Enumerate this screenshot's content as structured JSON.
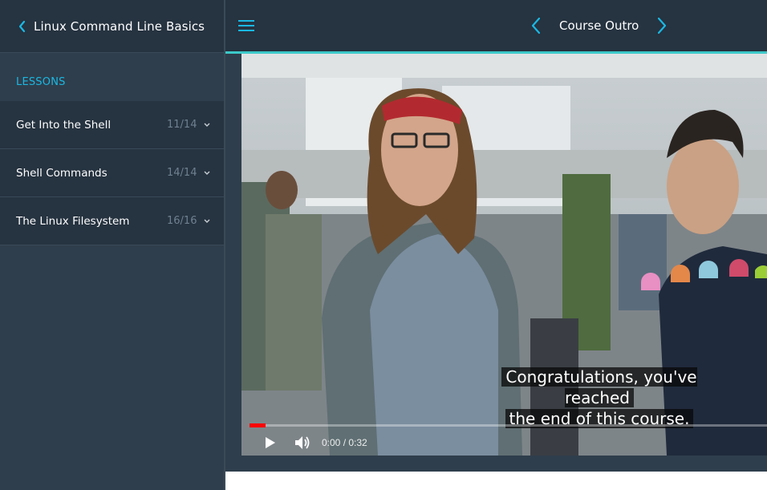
{
  "sidebar": {
    "course_title": "Linux Command Line Basics",
    "lessons_label": "LESSONS",
    "lessons": [
      {
        "name": "Get Into the Shell",
        "count": "11/14"
      },
      {
        "name": "Shell Commands",
        "count": "14/14"
      },
      {
        "name": "The Linux Filesystem",
        "count": "16/16"
      }
    ]
  },
  "header": {
    "lesson_title": "Course Outro"
  },
  "player": {
    "caption_line1": "Congratulations, you've reached",
    "caption_line2": "the end of this course.",
    "time": "0:00 / 0:32",
    "progress_fraction": 0.0
  },
  "colors": {
    "accent": "#1ab8e3",
    "teal": "#3cc9c9",
    "sidebar_bg": "#263340",
    "progress": "#ff0000"
  }
}
